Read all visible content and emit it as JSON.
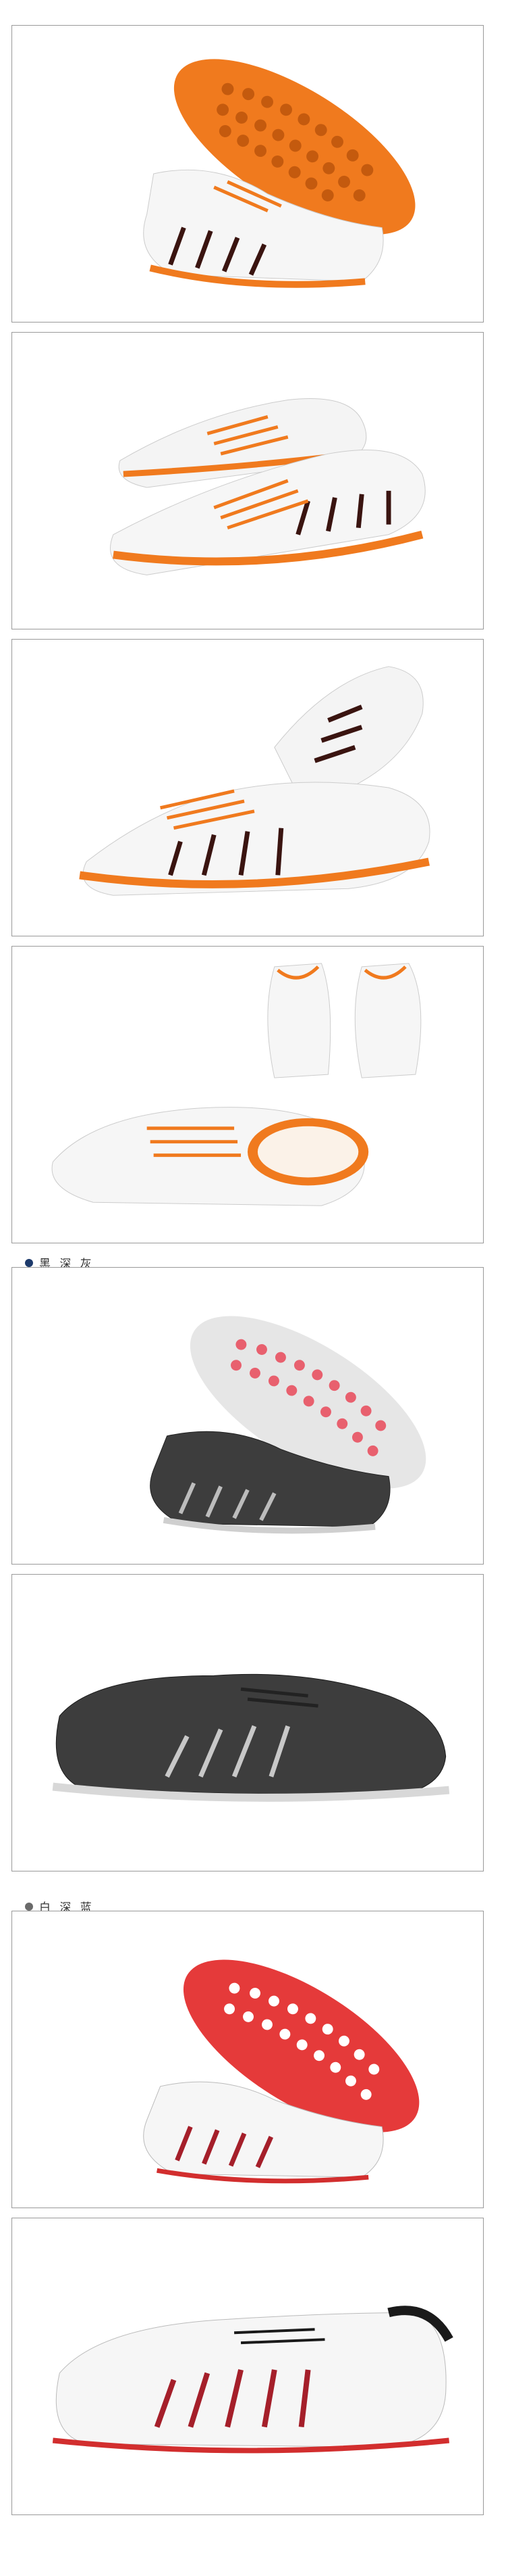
{
  "colors": {
    "orange": "#f07a1e",
    "dark_dot": "#1d3a6b",
    "grey_dot": "#6a6a6a",
    "panel_border": "#9a9a9a",
    "divider": "#bdbdbd"
  },
  "sections": [
    {
      "label": "黑 深 灰"
    },
    {
      "label": "白 深 蓝"
    }
  ],
  "images": [
    {
      "name": "orange-white-shoe-sole-view"
    },
    {
      "name": "orange-white-shoe-pair-front"
    },
    {
      "name": "orange-white-shoe-pair-side"
    },
    {
      "name": "orange-white-shoe-heel-insole"
    },
    {
      "name": "black-grey-shoe-sole-view"
    },
    {
      "name": "black-grey-shoe-side"
    },
    {
      "name": "white-blue-shoe-sole-view"
    },
    {
      "name": "white-blue-shoe-side"
    }
  ]
}
